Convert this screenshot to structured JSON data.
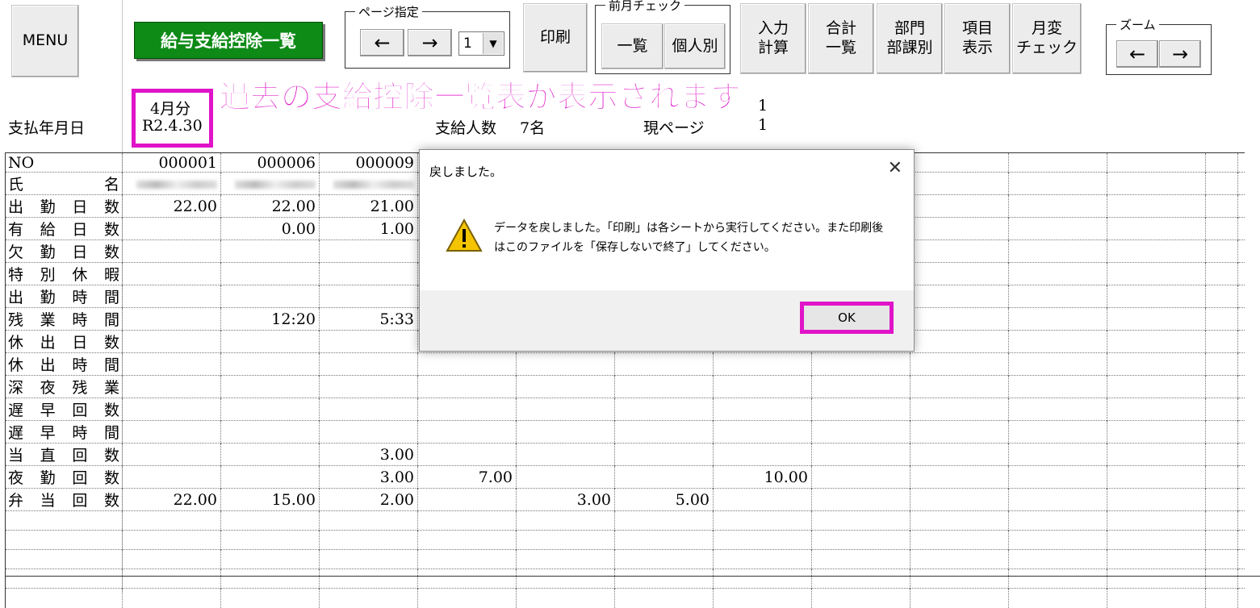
{
  "toolbar": {
    "menu": "MENU",
    "title": "給与支給控除一覧",
    "page_group_label": "ページ指定",
    "page_prev": "←",
    "page_next": "→",
    "page_value": "1",
    "print": "印刷",
    "prev_month_label": "前月チェック",
    "list": "一覧",
    "individual": "個人別",
    "input_calc": "入力\n計算",
    "total_list": "合計\n一覧",
    "dept": "部門\n部課別",
    "item_display": "項目\n表示",
    "monthly_change": "月変\nチェック",
    "zoom_label": "ズーム",
    "zoom_prev": "←",
    "zoom_next": "→"
  },
  "annotation": "過去の支給控除一覧表が表示されます",
  "header": {
    "month": "4月分",
    "date": "R2.4.30",
    "pay_date_label": "支払年月日",
    "payee_count_label": "支給人数",
    "payee_count": "7名",
    "total_pages_value": "1",
    "current_page_label": "現ページ",
    "current_page_value": "1"
  },
  "table": {
    "rows": [
      {
        "label": "NO",
        "cells": [
          "000001",
          "000006",
          "000009",
          "",
          "",
          "",
          "",
          "",
          "",
          "",
          "",
          ""
        ]
      },
      {
        "label": "氏名",
        "cells": [
          "",
          "",
          "",
          "",
          "",
          "",
          "",
          "",
          "",
          "",
          "",
          ""
        ]
      },
      {
        "label": "出勤日数",
        "cells": [
          "22.00",
          "22.00",
          "21.00",
          "",
          "",
          "",
          "",
          "",
          "",
          "",
          "",
          ""
        ]
      },
      {
        "label": "有給日数",
        "cells": [
          "",
          "0.00",
          "1.00",
          "",
          "",
          "",
          "",
          "",
          "",
          "",
          "",
          ""
        ]
      },
      {
        "label": "欠勤日数",
        "cells": [
          "",
          "",
          "",
          "",
          "",
          "",
          "",
          "",
          "",
          "",
          "",
          ""
        ]
      },
      {
        "label": "特別休暇",
        "cells": [
          "",
          "",
          "",
          "",
          "",
          "",
          "",
          "",
          "",
          "",
          "",
          ""
        ]
      },
      {
        "label": "出勤時間",
        "cells": [
          "",
          "",
          "",
          "",
          "",
          "",
          "",
          "",
          "",
          "",
          "",
          ""
        ]
      },
      {
        "label": "残業時間",
        "cells": [
          "",
          "12:20",
          "5:33",
          "",
          "",
          "",
          "",
          "",
          "",
          "",
          "",
          ""
        ]
      },
      {
        "label": "休出日数",
        "cells": [
          "",
          "",
          "",
          "",
          "",
          "",
          "",
          "",
          "",
          "",
          "",
          ""
        ]
      },
      {
        "label": "休出時間",
        "cells": [
          "",
          "",
          "",
          "",
          "",
          "",
          "",
          "",
          "",
          "",
          "",
          ""
        ]
      },
      {
        "label": "深夜残業",
        "cells": [
          "",
          "",
          "",
          "",
          "",
          "",
          "",
          "",
          "",
          "",
          "",
          ""
        ]
      },
      {
        "label": "遅早回数",
        "cells": [
          "",
          "",
          "",
          "",
          "",
          "",
          "",
          "",
          "",
          "",
          "",
          ""
        ]
      },
      {
        "label": "遅早時間",
        "cells": [
          "",
          "",
          "",
          "",
          "",
          "",
          "",
          "",
          "",
          "",
          "",
          ""
        ]
      },
      {
        "label": "当直回数",
        "cells": [
          "",
          "",
          "3.00",
          "",
          "",
          "",
          "",
          "",
          "",
          "",
          "",
          ""
        ]
      },
      {
        "label": "夜勤回数",
        "cells": [
          "",
          "",
          "3.00",
          "7.00",
          "",
          "",
          "10.00",
          "",
          "",
          "",
          "",
          ""
        ]
      },
      {
        "label": "弁当回数",
        "cells": [
          "22.00",
          "15.00",
          "2.00",
          "",
          "3.00",
          "5.00",
          "",
          "",
          "",
          "",
          "",
          ""
        ]
      },
      {
        "label": "",
        "cells": [
          "",
          "",
          "",
          "",
          "",
          "",
          "",
          "",
          "",
          "",
          "",
          ""
        ]
      },
      {
        "label": "",
        "cells": [
          "",
          "",
          "",
          "",
          "",
          "",
          "",
          "",
          "",
          "",
          "",
          ""
        ]
      },
      {
        "label": "",
        "cells": [
          "",
          "",
          "",
          "",
          "",
          "",
          "",
          "",
          "",
          "",
          "",
          ""
        ]
      },
      {
        "label": "",
        "cells": [
          "",
          "",
          "",
          "",
          "",
          "",
          "",
          "",
          "",
          "",
          "",
          ""
        ]
      },
      {
        "label": "",
        "cells": [
          "",
          "",
          "",
          "",
          "",
          "",
          "",
          "",
          "",
          "",
          "",
          ""
        ]
      }
    ]
  },
  "dialog": {
    "title": "戻しました。",
    "close": "✕",
    "message": "データを戻しました。「印刷」は各シートから実行してください。また印刷後はこのファイルを「保存しないで終了」してください。",
    "ok": "OK"
  }
}
